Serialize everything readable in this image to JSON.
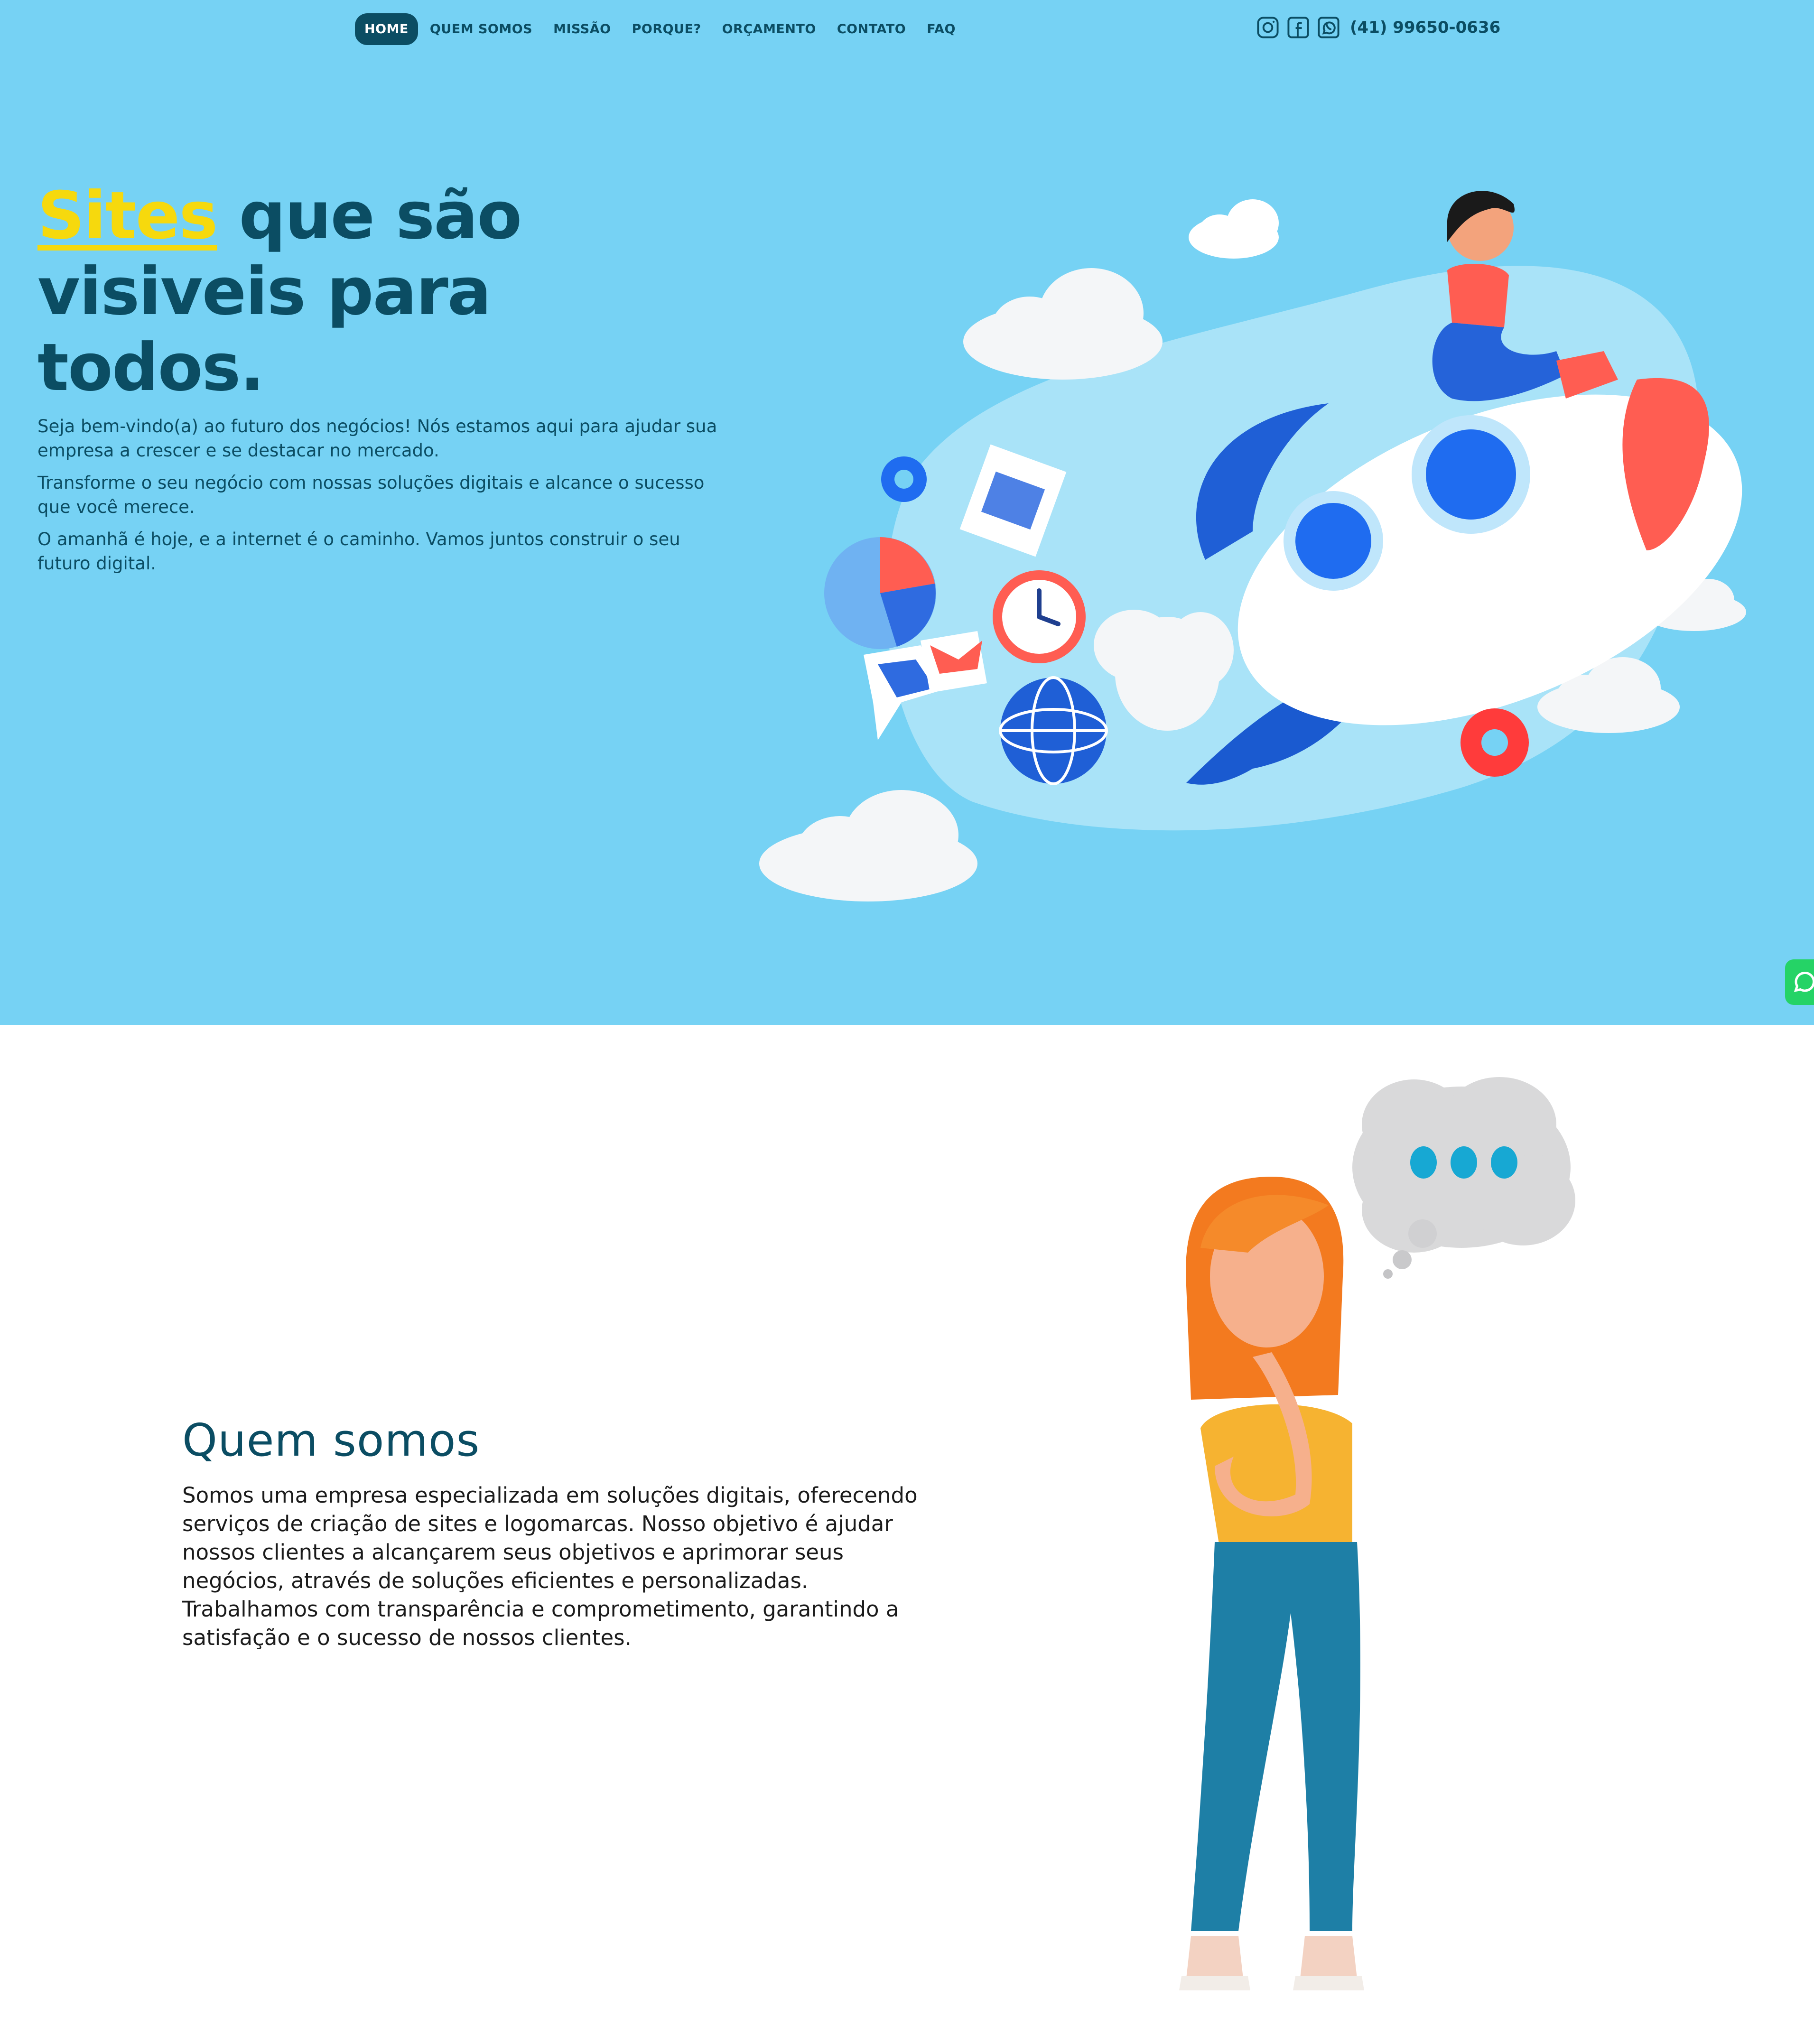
{
  "nav": {
    "items": [
      {
        "label": "HOME",
        "active": true
      },
      {
        "label": "QUEM SOMOS",
        "active": false
      },
      {
        "label": "MISSÃO",
        "active": false
      },
      {
        "label": "PORQUE?",
        "active": false
      },
      {
        "label": "ORÇAMENTO",
        "active": false
      },
      {
        "label": "CONTATO",
        "active": false
      },
      {
        "label": "FAQ",
        "active": false
      }
    ]
  },
  "contact": {
    "phone": "(41) 99650-0636",
    "social_icons": [
      "instagram-icon",
      "facebook-icon",
      "whatsapp-icon"
    ]
  },
  "hero": {
    "headline_highlight": "Sites",
    "headline_rest": " que são visiveis para todos.",
    "paragraphs": [
      "Seja bem-vindo(a) ao futuro dos negócios! Nós estamos aqui para ajudar sua empresa a crescer e se destacar no mercado.",
      "Transforme o seu negócio com nossas soluções digitais e alcance o sucesso que você merece.",
      "O amanhã é hoje, e a internet é o caminho. Vamos juntos construir o seu futuro digital."
    ]
  },
  "about": {
    "title": "Quem somos",
    "text": "Somos uma empresa especializada em soluções digitais, oferecendo serviços de criação de sites e logomarcas. Nosso objetivo é ajudar nossos clientes a alcançarem seus objetivos e aprimorar seus negócios, através de soluções eficientes e personalizadas. Trabalhamos com transparência e comprometimento, garantindo a satisfação e o sucesso de nossos clientes."
  },
  "colors": {
    "hero_bg": "#76d2f4",
    "primary": "#0b4d63",
    "highlight": "#f6d90d",
    "whatsapp": "#25d366"
  }
}
